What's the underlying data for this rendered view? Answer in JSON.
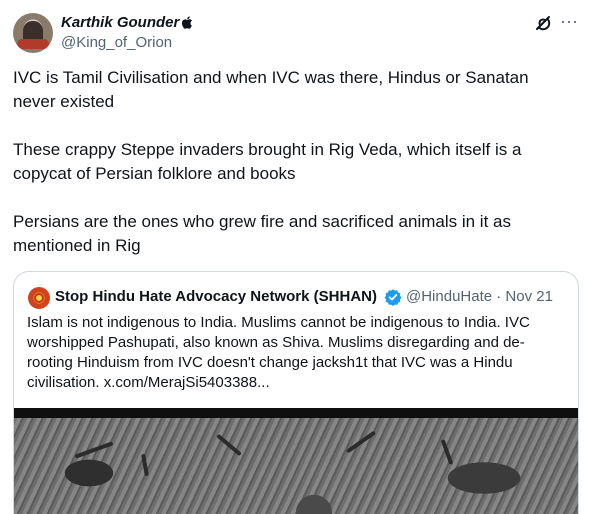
{
  "author": {
    "name": "Karthik Gounder",
    "handle": "@King_of_Orion",
    "badge_icon": "apple-icon"
  },
  "header_actions": {
    "grok_icon": "grok-icon",
    "more_icon": "more-icon",
    "more_glyph": "···"
  },
  "post": {
    "paragraphs": [
      "IVC is Tamil Civilisation and when IVC was there,  Hindus or Sanatan never existed",
      "These crappy Steppe invaders brought in Rig Veda, which itself is a copycat of Persian folklore and books",
      "Persians are the ones who grew fire and sacrificed animals in it as mentioned in Rig"
    ]
  },
  "quote": {
    "name": "Stop Hindu Hate Advocacy Network (SHHAN)",
    "verified": true,
    "handle_date": "@HinduHate · Nov 21",
    "text": "Islam is not indigenous to India. Muslims cannot be indigenous to India.  IVC worshipped Pashupati, also known as Shiva. Muslims disregarding and de-rooting Hinduism from IVC doesn't change jacksh1t that IVC was a Hindu civilisation.  x.com/MerajSi5403388...",
    "media_icon": "seal-image"
  },
  "colors": {
    "text": "#0f1419",
    "secondary": "#536471",
    "border": "#cfd9de",
    "verified": "#1d9bf0"
  }
}
